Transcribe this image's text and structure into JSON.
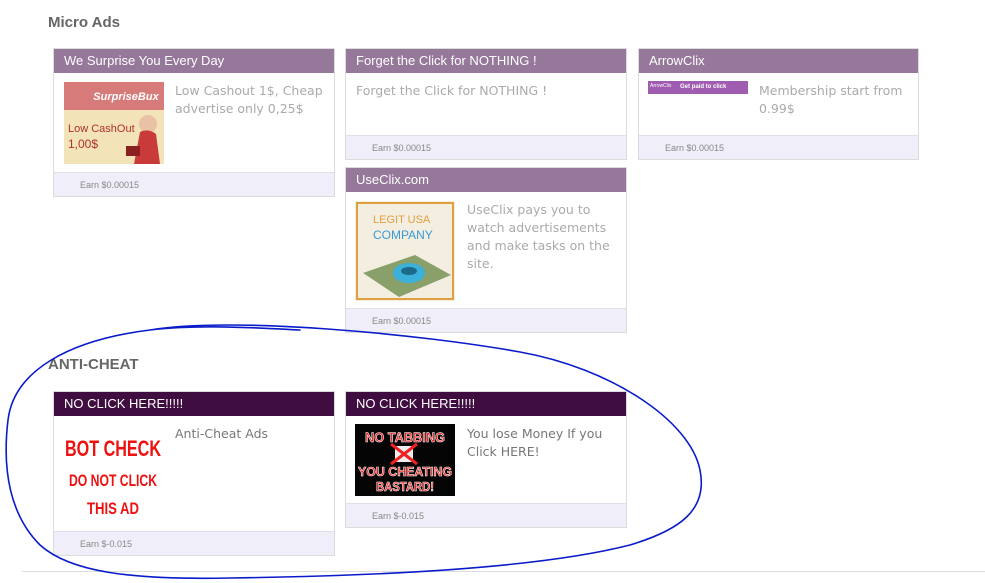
{
  "sections": {
    "micro_ads": {
      "title": "Micro Ads"
    },
    "anti_cheat": {
      "title": "ANTI-CHEAT"
    }
  },
  "ads": {
    "surprise": {
      "title": "We Surprise You Every Day",
      "desc": "Low Cashout 1$, Cheap advertise only 0,25$",
      "earn": "Earn $0.00015",
      "banner_brand": "SurpriseBux",
      "banner_line1": "Low CashOut",
      "banner_line2": "1,00$"
    },
    "forget": {
      "title": "Forget the Click for NOTHING !",
      "desc": "Forget the Click for NOTHING !",
      "earn": "Earn $0.00015"
    },
    "arrowclix": {
      "title": "ArrowClix",
      "desc": "Membership start from 0.99$",
      "earn": "Earn $0.00015",
      "banner_brand": "ArrowClix",
      "banner_text": "Get paid to click"
    },
    "useclix": {
      "title": "UseClix.com",
      "desc": "UseClix pays you to watch advertisements and make tasks on the site.",
      "earn": "Earn $0.00015",
      "banner_line1": "LEGIT USA",
      "banner_line2": "COMPANY"
    },
    "nocheck1": {
      "title": "NO CLICK HERE!!!!!",
      "desc": "Anti-Cheat Ads",
      "earn": "Earn $-0.015",
      "banner_line1": "BOT CHECK",
      "banner_line2": "DO NOT CLICK",
      "banner_line3": "THIS AD"
    },
    "nocheck2": {
      "title": "NO CLICK HERE!!!!!",
      "desc": "You lose Money If you Click HERE!",
      "earn": "Earn $-0.015",
      "banner_line1": "NO TABBING",
      "banner_line2": "YOU CHEATING",
      "banner_line3": "BASTARD!"
    }
  },
  "colors": {
    "header_purple": "#96789a",
    "header_dark": "#3f0d3f",
    "annotation_blue": "#0a1bc9"
  }
}
